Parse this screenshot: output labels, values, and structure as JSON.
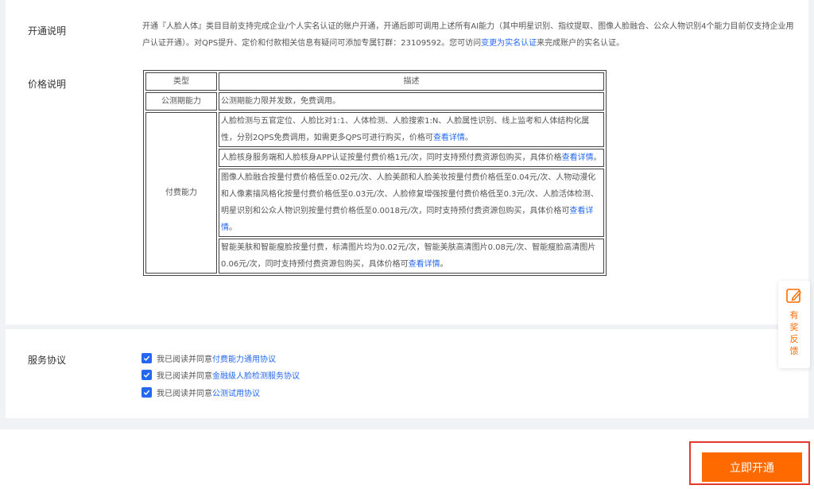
{
  "open_info": {
    "label": "开通说明",
    "line1_text": "开通『人脸人体』类目目前支持完成企业/个人实名认证的账户开通，开通后即可调用上述所有AI能力（其中明星识别、指纹提取、图像人脸融合、公众人物识别4个能力目前仅支持企业用户认证开通）。对QPS提升、定价和付款相关信息有疑问可添加专属钉群：23109592。您可访问",
    "link": "变更为实名认证",
    "tail": "来完成账户的实名认证。"
  },
  "price_info": {
    "label": "价格说明",
    "header_type": "类型",
    "header_desc": "描述",
    "public_type": "公测期能力",
    "public_desc": "公测期能力限并发数，免费调用。",
    "paid_type": "付费能力",
    "paid_rows": [
      {
        "text": "人脸检测与五官定位、人脸比对1:1、人体检测、人脸搜索1:N、人脸属性识别、线上监考和人体结构化属性，分别2QPS免费调用，如需更多QPS可进行购买，价格可",
        "link": "查看详情",
        "tail": "。"
      },
      {
        "text": "人脸核身服务端和人脸核身APP认证按量付费价格1元/次，同时支持预付费资源包购买，具体价格",
        "link": "查看详情",
        "tail": "。"
      },
      {
        "text": "图像人脸融合按量付费价格低至0.02元/次、人脸美颜和人脸美妆按量付费价格低至0.04元/次、人物动漫化和人像素描风格化按量付费价格低至0.03元/次、人脸修复增强按量付费价格低至0.3元/次、人脸活体检测、明星识别和公众人物识别按量付费价格低至0.0018元/次，同时支持预付费资源包购买，具体价格可",
        "link": "查看详情",
        "tail": "。"
      },
      {
        "text": "智能美肤和智能瘦脸按量付费，标清图片均为0.02元/次，智能美肤高清图片0.08元/次、智能瘦脸高清图片0.06元/次，同时支持预付费资源包购买，具体价格可",
        "link": "查看详情",
        "tail": "。"
      }
    ]
  },
  "agreements": {
    "label": "服务协议",
    "items": [
      {
        "prefix": "我已阅读并同意",
        "link": "付费能力通用协议"
      },
      {
        "prefix": "我已阅读并同意",
        "link": "金融级人脸检测服务协议"
      },
      {
        "prefix": "我已阅读并同意",
        "link": "公测试用协议"
      }
    ]
  },
  "feedback": {
    "text": "有奖反馈",
    "icon": "edit-icon"
  },
  "open_button": {
    "label": "立即开通",
    "color": "#ff6a00",
    "highlight": "#e3382e"
  }
}
